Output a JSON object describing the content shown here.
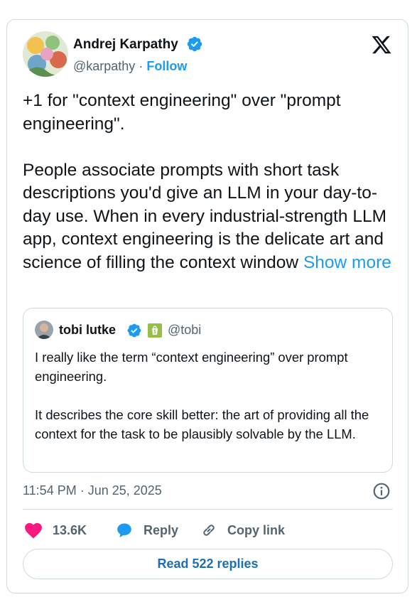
{
  "author": {
    "name": "Andrej Karpathy",
    "handle": "@karpathy",
    "separator": "·",
    "follow_label": "Follow"
  },
  "tweet": {
    "text": "+1 for \"context engineering\" over \"prompt engineering\".\n\nPeople associate prompts with short task descriptions you'd give an LLM in your day-to-day use. When in every industrial-strength LLM app, context engineering is the delicate art and science of filling the context window ",
    "show_more_label": "Show more"
  },
  "quoted_tweet": {
    "name": "tobi lutke",
    "handle": "@tobi",
    "text": "I really like the term “context engineering” over prompt engineering.\n\nIt describes the core skill better: the art of providing all the context for the task to be plausibly solvable by the LLM."
  },
  "meta": {
    "timestamp": "11:54 PM · Jun 25, 2025"
  },
  "actions": {
    "like_count": "13.6K",
    "reply_label": "Reply",
    "copy_link_label": "Copy link",
    "read_replies_label": "Read 522 replies"
  },
  "colors": {
    "accent": "#1d9bf0",
    "like": "#f91880",
    "text": "#0f1419",
    "secondary": "#536471",
    "border": "#cfd9de"
  },
  "icons": [
    "verified-badge-icon",
    "x-logo-icon",
    "shopify-icon",
    "info-icon",
    "heart-icon",
    "reply-bubble-icon",
    "link-icon"
  ]
}
